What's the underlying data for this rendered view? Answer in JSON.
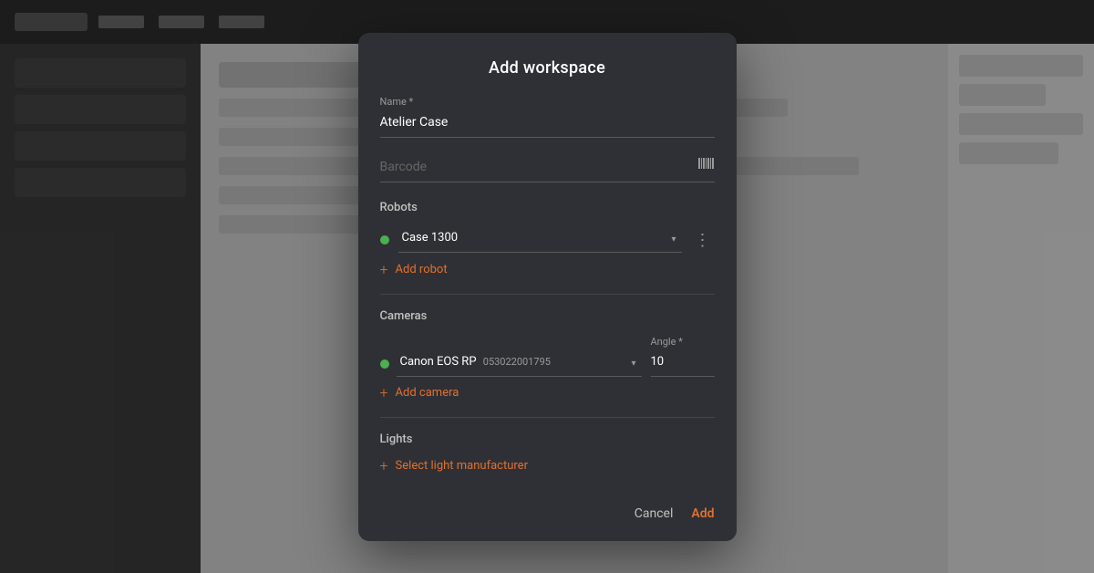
{
  "background": {
    "topbar_color": "#2c2c2c",
    "sidebar_color": "#3a3a3a",
    "main_color": "#c8c8c8"
  },
  "modal": {
    "title": "Add workspace",
    "name_label": "Name *",
    "name_value": "Atelier Case",
    "barcode_placeholder": "Barcode",
    "sections": {
      "robots": {
        "title": "Robots",
        "robot_name": "Case 1300",
        "add_robot_label": "Add robot"
      },
      "cameras": {
        "title": "Cameras",
        "camera_name": "Canon EOS RP",
        "camera_serial": "053022001795",
        "angle_label": "Angle *",
        "angle_value": "10",
        "add_camera_label": "Add camera"
      },
      "lights": {
        "title": "Lights",
        "select_light_label": "Select light manufacturer"
      }
    },
    "footer": {
      "cancel_label": "Cancel",
      "add_label": "Add"
    }
  }
}
